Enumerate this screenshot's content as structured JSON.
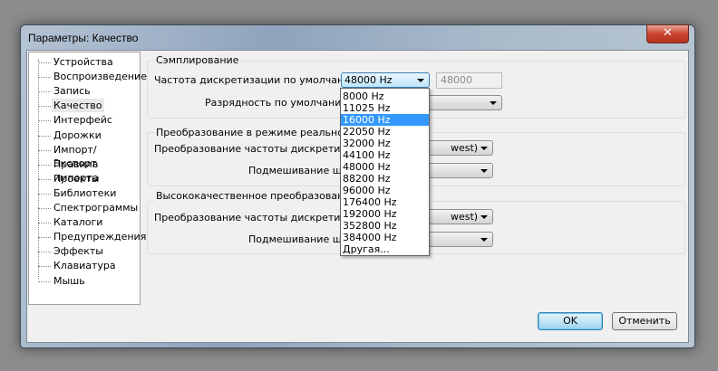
{
  "window": {
    "title": "Параметры: Качество",
    "close_icon": "close-icon"
  },
  "sidebar": {
    "items": [
      {
        "label": "Устройства"
      },
      {
        "label": "Воспроизведение"
      },
      {
        "label": "Запись"
      },
      {
        "label": "Качество",
        "selected": true
      },
      {
        "label": "Интерфейс"
      },
      {
        "label": "Дорожки"
      },
      {
        "label": "Импорт/Экспорт"
      },
      {
        "label": "Правила импорта"
      },
      {
        "label": "Проекты"
      },
      {
        "label": "Библиотеки"
      },
      {
        "label": "Спектрограммы"
      },
      {
        "label": "Каталоги"
      },
      {
        "label": "Предупреждения"
      },
      {
        "label": "Эффекты"
      },
      {
        "label": "Клавиатура"
      },
      {
        "label": "Мышь"
      }
    ]
  },
  "sampling": {
    "title": "Сэмплирование",
    "rate_label": "Частота дискретизации по умолчанию:",
    "rate_value": "48000 Hz",
    "rate_custom": "48000",
    "format_label": "Разрядность по умолчанию:",
    "format_value": ""
  },
  "realtime": {
    "title": "Преобразование в режиме реального вр",
    "converter_label": "Преобразование частоты дискретизаци",
    "converter_value": "west)",
    "dither_label": "Подмешивание шума",
    "dither_value": ""
  },
  "hq": {
    "title": "Высококачественное преобразование",
    "converter_label": "Преобразование частоты дискретизаци",
    "converter_value": "west)",
    "dither_label": "Подмешивание шума",
    "dither_value": ""
  },
  "dropdown": {
    "options": [
      "8000 Hz",
      "11025 Hz",
      "16000 Hz",
      "22050 Hz",
      "32000 Hz",
      "44100 Hz",
      "48000 Hz",
      "88200 Hz",
      "96000 Hz",
      "176400 Hz",
      "192000 Hz",
      "352800 Hz",
      "384000 Hz",
      "Другая..."
    ],
    "highlighted": "16000 Hz"
  },
  "buttons": {
    "ok": "OK",
    "cancel": "Отменить"
  },
  "colors": {
    "highlight": "#3399ff",
    "close": "#c9452f"
  }
}
